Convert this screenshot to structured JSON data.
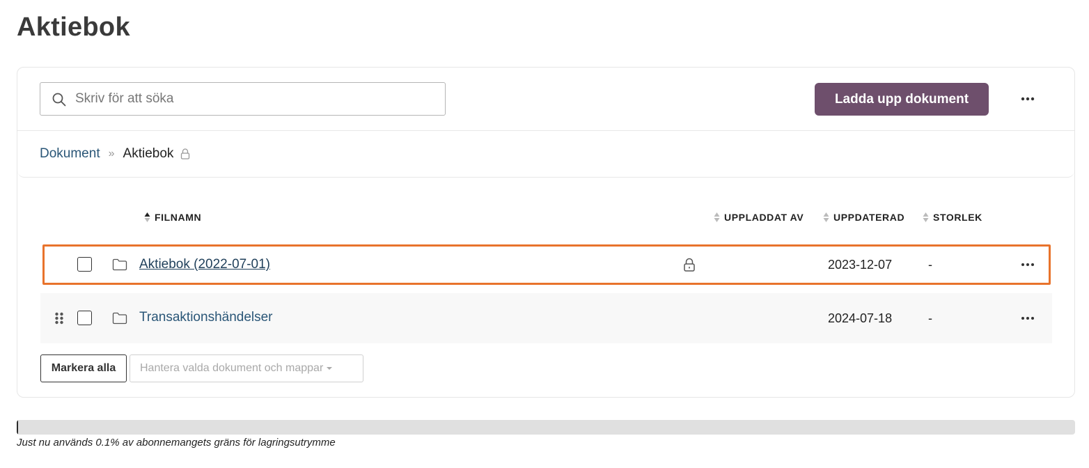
{
  "page": {
    "title": "Aktiebok"
  },
  "toolbar": {
    "search_placeholder": "Skriv för att söka",
    "search_value": "",
    "upload_label": "Ladda upp dokument",
    "more_icon": "ellipsis-icon"
  },
  "breadcrumb": {
    "root": "Dokument",
    "separator": "»",
    "current": "Aktiebok",
    "current_icon": "lock-icon"
  },
  "table": {
    "columns": {
      "filename": "FILNAMN",
      "uploaded_by": "UPPLADDAT AV",
      "updated": "UPPDATERAD",
      "size": "STORLEK"
    },
    "rows": [
      {
        "name": "Aktiebok (2022-07-01)",
        "locked": true,
        "uploaded_by": "",
        "updated": "2023-12-07",
        "size": "-",
        "selected": true
      },
      {
        "name": "Transaktionshändelser",
        "locked": false,
        "uploaded_by": "",
        "updated": "2024-07-18",
        "size": "-",
        "selected": false
      }
    ]
  },
  "actions": {
    "select_all": "Markera alla",
    "manage_selected": "Hantera valda dokument och mappar"
  },
  "storage": {
    "used_fraction": 0.001,
    "text": "Just nu används 0.1% av abonnemangets gräns för lagringsutrymme"
  },
  "colors": {
    "primary": "#6e4f6c",
    "link": "#2a5677",
    "highlight": "#e8732c"
  }
}
